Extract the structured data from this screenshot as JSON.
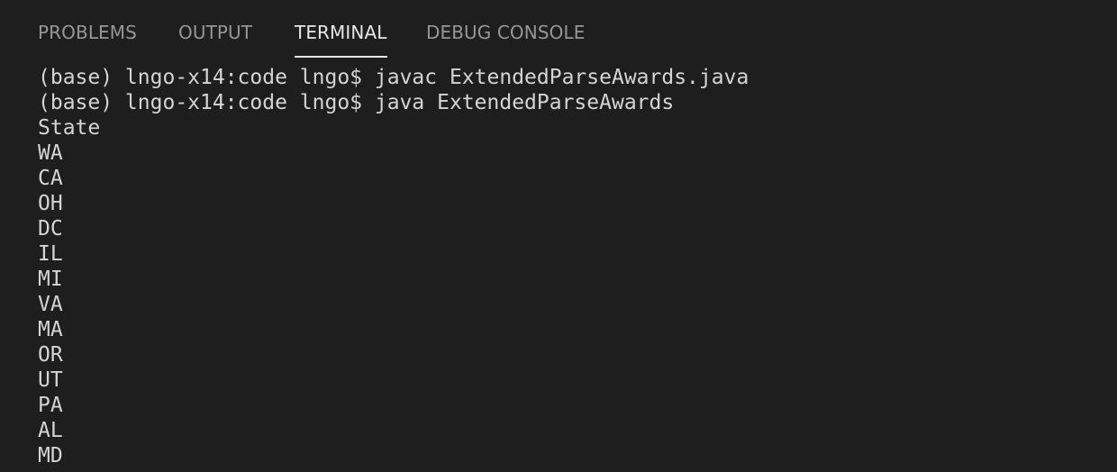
{
  "panel": {
    "tabs": [
      {
        "label": "PROBLEMS",
        "active": false
      },
      {
        "label": "OUTPUT",
        "active": false
      },
      {
        "label": "TERMINAL",
        "active": true
      },
      {
        "label": "DEBUG CONSOLE",
        "active": false
      }
    ]
  },
  "terminal": {
    "lines": [
      "(base) lngo-x14:code lngo$ javac ExtendedParseAwards.java",
      "(base) lngo-x14:code lngo$ java ExtendedParseAwards",
      "State",
      "WA",
      "CA",
      "OH",
      "DC",
      "IL",
      "MI",
      "VA",
      "MA",
      "OR",
      "UT",
      "PA",
      "AL",
      "MD"
    ]
  },
  "colors": {
    "background": "#1e1e1e",
    "tab_inactive": "#969696",
    "tab_active": "#e7e7e7",
    "terminal_text": "#d4d4d4"
  }
}
